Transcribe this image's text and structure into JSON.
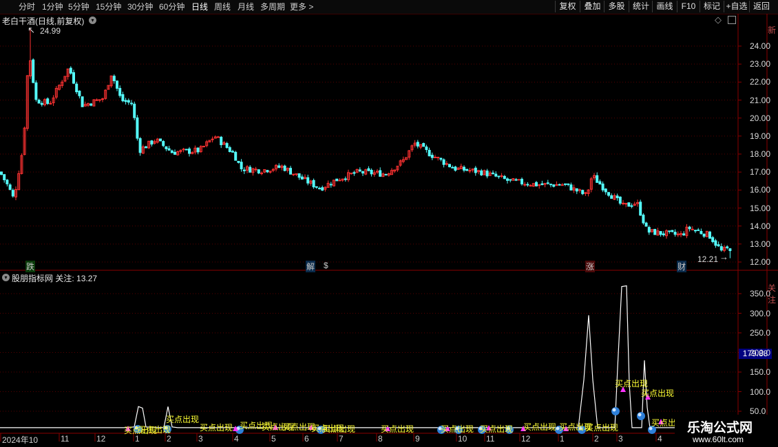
{
  "toolbar": {
    "periods": [
      "分时",
      "1分钟",
      "5分钟",
      "15分钟",
      "30分钟",
      "60分钟",
      "日线",
      "周线",
      "月线",
      "多周期",
      "更多 >"
    ],
    "active_period": "日线",
    "buttons": [
      "复权",
      "叠加",
      "多股",
      "统计",
      "画线",
      "F10",
      "标记",
      "+自选",
      "返回"
    ]
  },
  "price_chart": {
    "title": "老白干酒(日线,前复权)",
    "y_ticks": [
      "24.00",
      "23.00",
      "22.00",
      "21.00",
      "20.00",
      "19.00",
      "18.00",
      "17.00",
      "16.00",
      "15.00",
      "14.00",
      "13.00",
      "12.00"
    ],
    "high_label": "24.99",
    "low_label": "12.21",
    "events": [
      {
        "text": "跌",
        "color": "#22aa22"
      },
      {
        "text": "解",
        "color": "#2a8ad8"
      },
      {
        "text": "$",
        "color": "#ff3030"
      },
      {
        "text": "涨",
        "color": "#d83030"
      },
      {
        "text": "财",
        "color": "#2a8ad8"
      }
    ],
    "up_color": "#ff3232",
    "down_color": "#54fcfc"
  },
  "indicator": {
    "name": "股朋指标网",
    "focus_label": "关注: 13.27",
    "y_ticks": [
      "350.0",
      "300.0",
      "250.0",
      "200.0",
      "150.0",
      "100.0",
      "50.0"
    ],
    "highlight_value": "179.88",
    "signal_text": "买点出现",
    "signal_color": "#ffff33",
    "marker_color": "#ff33ff"
  },
  "date_axis": [
    "2024年10",
    "11",
    "12",
    "1",
    "2",
    "3",
    "4",
    "5",
    "6",
    "7",
    "8",
    "9",
    "10",
    "11",
    "12",
    "1",
    "2",
    "3",
    "4"
  ],
  "right_strip": {
    "top": "新",
    "bottom": "关注"
  },
  "watermark": {
    "title": "乐淘公式网",
    "url": "www.60lt.com"
  }
}
